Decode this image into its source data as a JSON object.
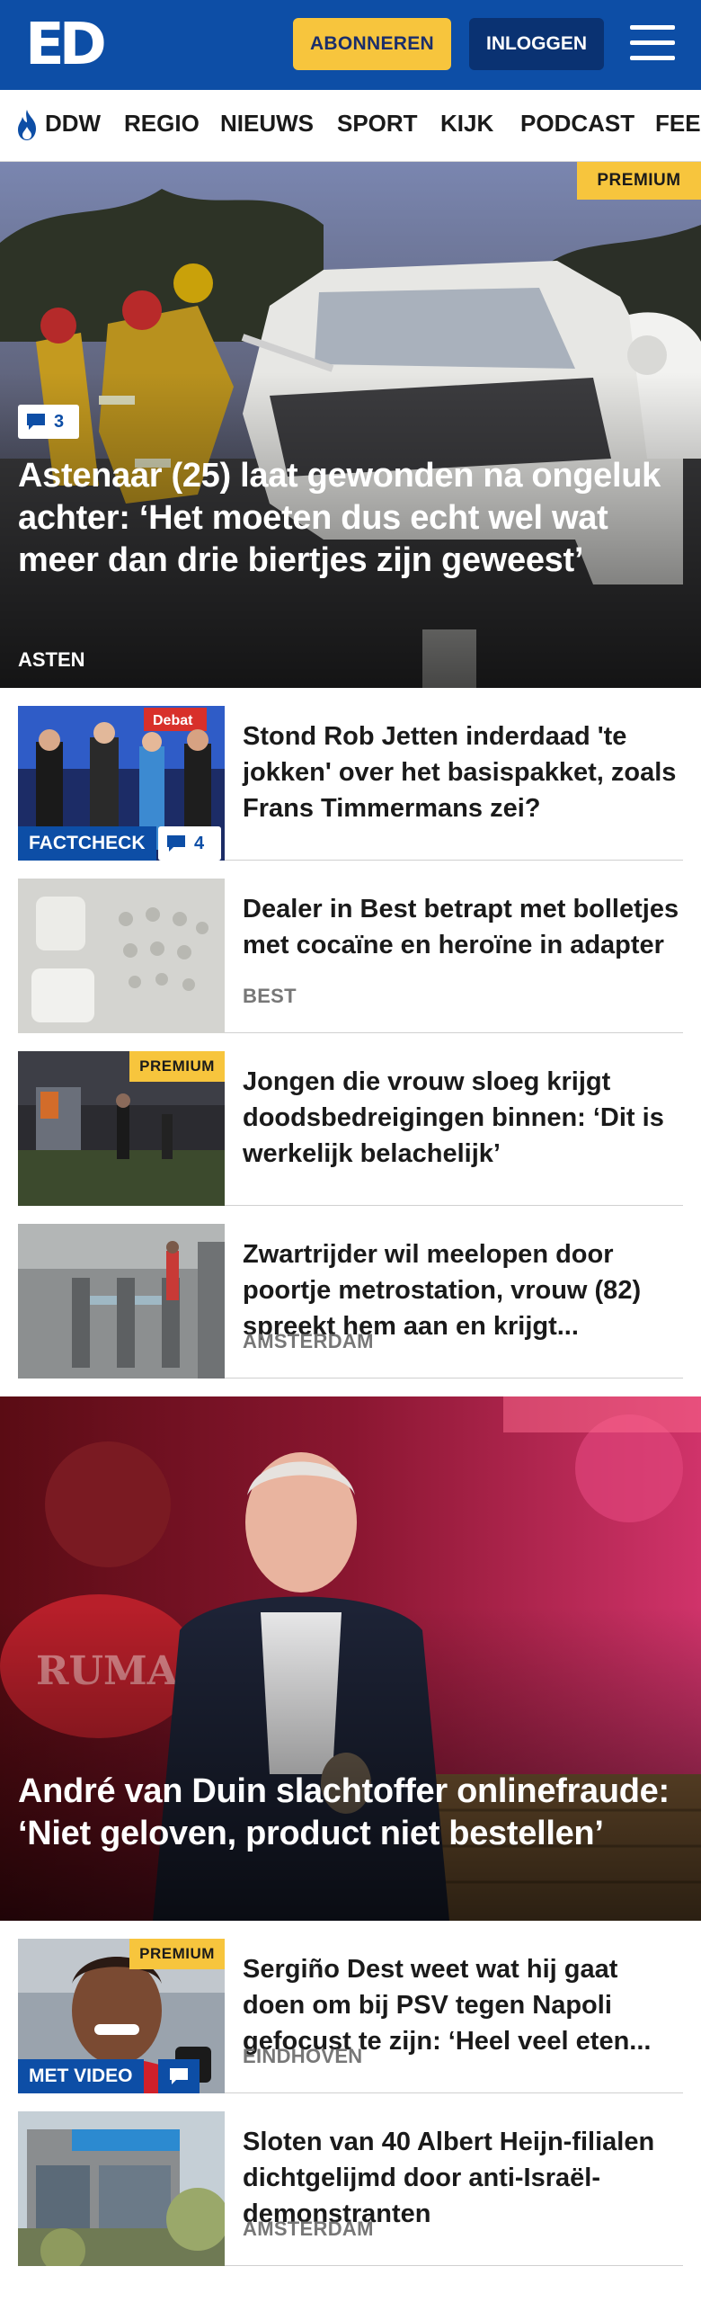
{
  "header": {
    "logo": "ED",
    "subscribe_label": "ABONNEREN",
    "login_label": "INLOGGEN"
  },
  "nav": {
    "items": [
      "DDW",
      "REGIO",
      "NIEUWS",
      "SPORT",
      "KIJK",
      "PODCAST",
      "FEE"
    ]
  },
  "hero1": {
    "premium": "PREMIUM",
    "comments": "3",
    "title": "Astenaar (25) laat gewonden na ongeluk achter: ‘Het moeten dus echt wel wat meer dan drie biertjes zijn geweest’",
    "tag": "ASTEN"
  },
  "articles1": [
    {
      "title": "Stond Rob Jetten inderdaad 'te jokken' over het basispakket, zoals Frans Timmermans zei?",
      "label": "FACTCHECK",
      "comments": "4",
      "tv_text": "Debat"
    },
    {
      "title": "Dealer in Best betrapt met bolletjes met cocaïne en heroïne in adapter",
      "tag": "BEST"
    },
    {
      "title": "Jongen die vrouw sloeg krijgt doodsbedreigingen binnen: ‘Dit is werkelijk belachelijk’",
      "premium": "PREMIUM"
    },
    {
      "title": "Zwartrijder wil meelopen door poortje metrostation, vrouw (82) spreekt hem aan en krijgt...",
      "tag": "AMSTERDAM"
    }
  ],
  "hero2": {
    "title": "André van Duin slachtoffer onlinefraude: ‘Niet geloven, product niet bestellen’"
  },
  "articles2": [
    {
      "title": "Sergiño Dest weet wat hij gaat doen om bij PSV tegen Napoli gefocust te zijn: ‘Heel veel eten...",
      "tag": "EINDHOVEN",
      "premium": "PREMIUM",
      "label": "MET VIDEO"
    },
    {
      "title": "Sloten van 40 Albert Heijn-filialen dichtgelijmd door anti-Is­raël-demonstranten",
      "tag": "AMSTERDAM"
    }
  ],
  "colors": {
    "brand_blue": "#0d4ea6",
    "premium_yellow": "#f7c53d",
    "login_dark_blue": "#0a3272"
  }
}
